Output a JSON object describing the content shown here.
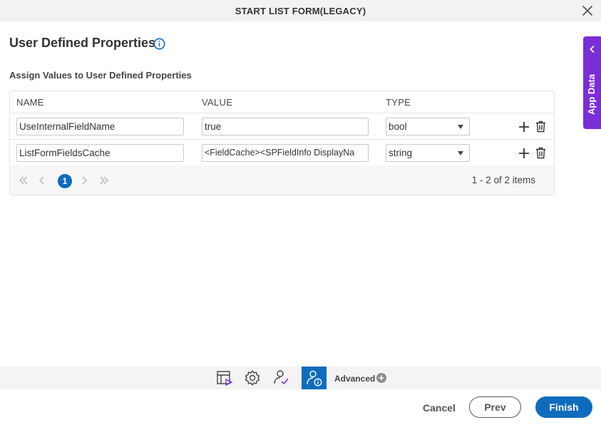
{
  "window": {
    "title": "START LIST FORM(LEGACY)",
    "close_icon": "close-icon"
  },
  "section": {
    "title": "User Defined Properties",
    "info_icon": "info-icon",
    "subtitle": "Assign Values to User Defined Properties"
  },
  "table": {
    "headers": {
      "name": "NAME",
      "value": "VALUE",
      "type": "TYPE"
    },
    "rows": [
      {
        "name": "UseInternalFieldName",
        "value": "true",
        "type": "bool"
      },
      {
        "name": "ListFormFieldsCache",
        "value": "<FieldCache><SPFieldInfo DisplayNa",
        "type": "string"
      }
    ],
    "row_actions": {
      "add_icon": "plus-icon",
      "delete_icon": "trash-icon"
    }
  },
  "pager": {
    "current_page": "1",
    "summary": "1 - 2 of 2 items"
  },
  "side_panel": {
    "label": "App Data",
    "icon": "chevron-left-icon"
  },
  "toolbar": {
    "icons": [
      "form-icon",
      "gear-icon",
      "user-task-icon",
      "user-info-icon"
    ],
    "advanced_label": "Advanced",
    "advanced_icon": "plus-circle-icon"
  },
  "footer": {
    "cancel": "Cancel",
    "prev": "Prev",
    "finish": "Finish"
  },
  "colors": {
    "accent": "#0f6cbd",
    "side_panel": "#7a2ed8"
  }
}
